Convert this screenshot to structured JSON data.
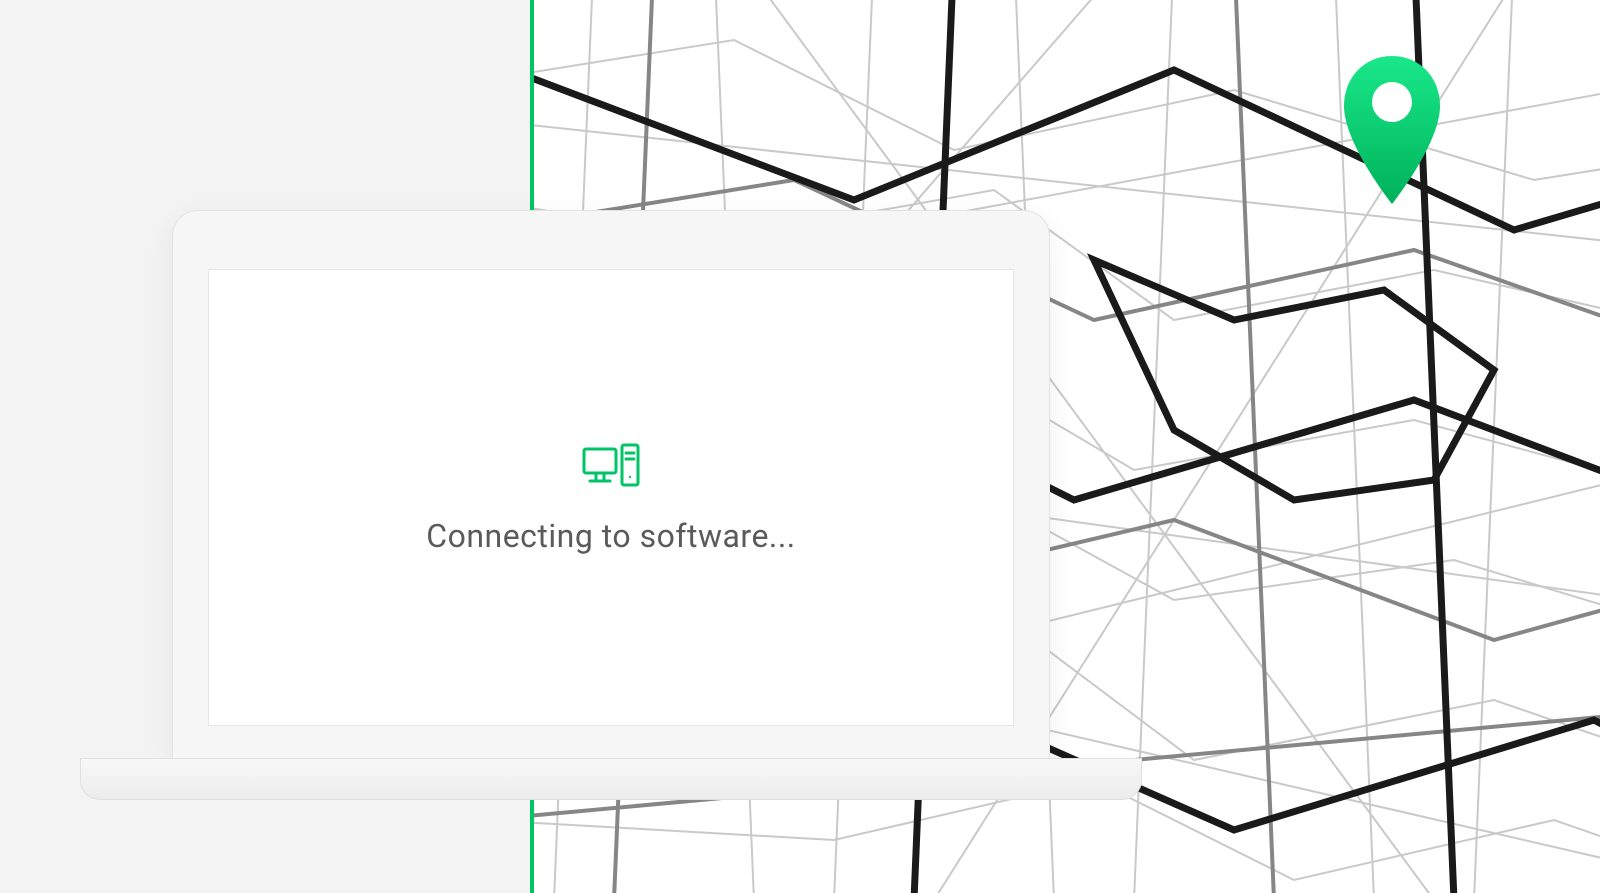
{
  "colors": {
    "accent": "#00c567",
    "pin_gradient_top": "#19e88a",
    "pin_gradient_bottom": "#00b158",
    "text": "#5a5a5a",
    "background_left": "#f3f3f3",
    "background_map": "#ffffff"
  },
  "screen": {
    "status_text": "Connecting to software..."
  },
  "icons": {
    "computer": "computer-icon",
    "map_pin": "map-pin-icon"
  }
}
